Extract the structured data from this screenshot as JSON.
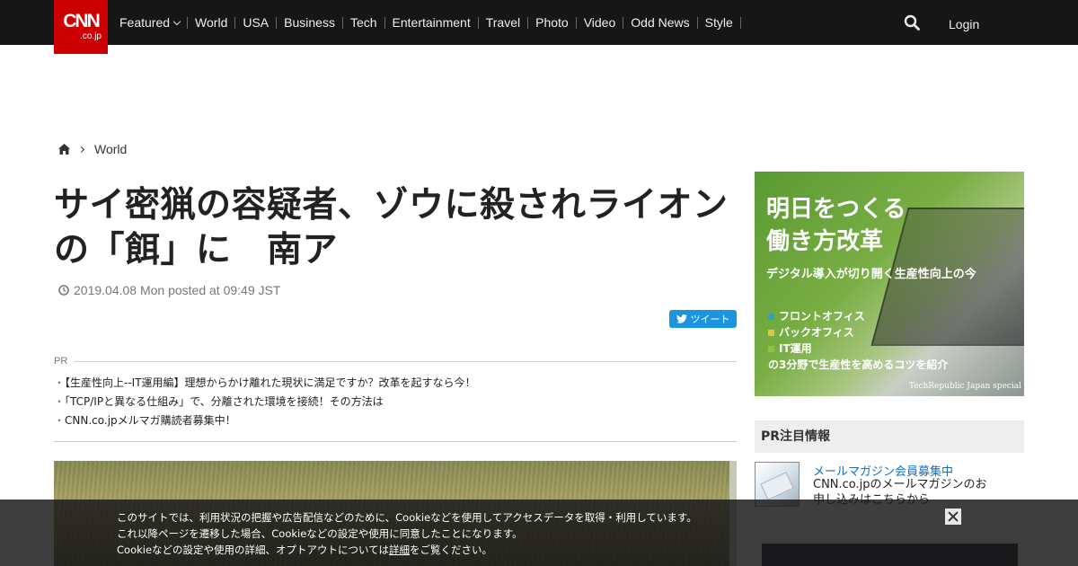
{
  "header": {
    "logo": {
      "brand": "CNN",
      "suffix": ".co.jp"
    },
    "nav": [
      {
        "label": "Featured"
      },
      {
        "label": "World"
      },
      {
        "label": "USA"
      },
      {
        "label": "Business"
      },
      {
        "label": "Tech"
      },
      {
        "label": "Entertainment"
      },
      {
        "label": "Travel"
      },
      {
        "label": "Photo"
      },
      {
        "label": "Video"
      },
      {
        "label": "Odd News"
      },
      {
        "label": "Style"
      }
    ],
    "search_icon": "search-icon",
    "login_label": "Login"
  },
  "breadcrumb": {
    "home_icon": "home-icon",
    "current": "World"
  },
  "article": {
    "title": "サイ密猟の容疑者、ゾウに殺されライオンの「餌」に　南ア",
    "date": "2019.04.08 Mon posted at 09:49 JST",
    "tweet_label": "ツイート"
  },
  "pr": {
    "label": "PR",
    "items": [
      "【生産性向上--IT運用編】理想からかけ離れた現状に満足ですか？改革を起すなら今！",
      "「TCP/IPと異なる仕組み」で、分離された環境を接続！その方法は",
      "CNN.co.jpメルマガ購読者募集中！"
    ]
  },
  "sidebar": {
    "ad": {
      "headline_1": "明日をつくる",
      "headline_2": "働き方改革",
      "sub": "デジタル導入が切り開く生産性向上の今",
      "items": [
        {
          "label": "フロントオフィス",
          "color": "#29a3d6"
        },
        {
          "label": "バックオフィス",
          "color": "#e3c443"
        },
        {
          "label": "IT運用",
          "color": "#8bc43f"
        }
      ],
      "footer": "の3分野で生産性を高めるコツを紹介",
      "brand": "TechRepublic Japan special"
    },
    "pr_box": {
      "title": "PR注目情報",
      "item_title": "メールマガジン会員募集中",
      "item_desc": "CNN.co.jpのメールマガジンのお申し込みはこちらから"
    }
  },
  "cookie": {
    "line1": "このサイトでは、利用状況の把握や広告配信などのために、Cookieなどを使用してアクセスデータを取得・利用しています。",
    "line2": "これ以降ページを遷移した場合、Cookieなどの設定や使用に同意したことになります。",
    "line3_pre": "Cookieなどの設定や使用の詳細、オプトアウトについては",
    "line3_link": "詳細",
    "line3_post": "をご覧ください。"
  },
  "colors": {
    "brand": "#cc0000",
    "topbar": "#161616",
    "link": "#1a6dba",
    "tweet": "#1b95e0"
  }
}
